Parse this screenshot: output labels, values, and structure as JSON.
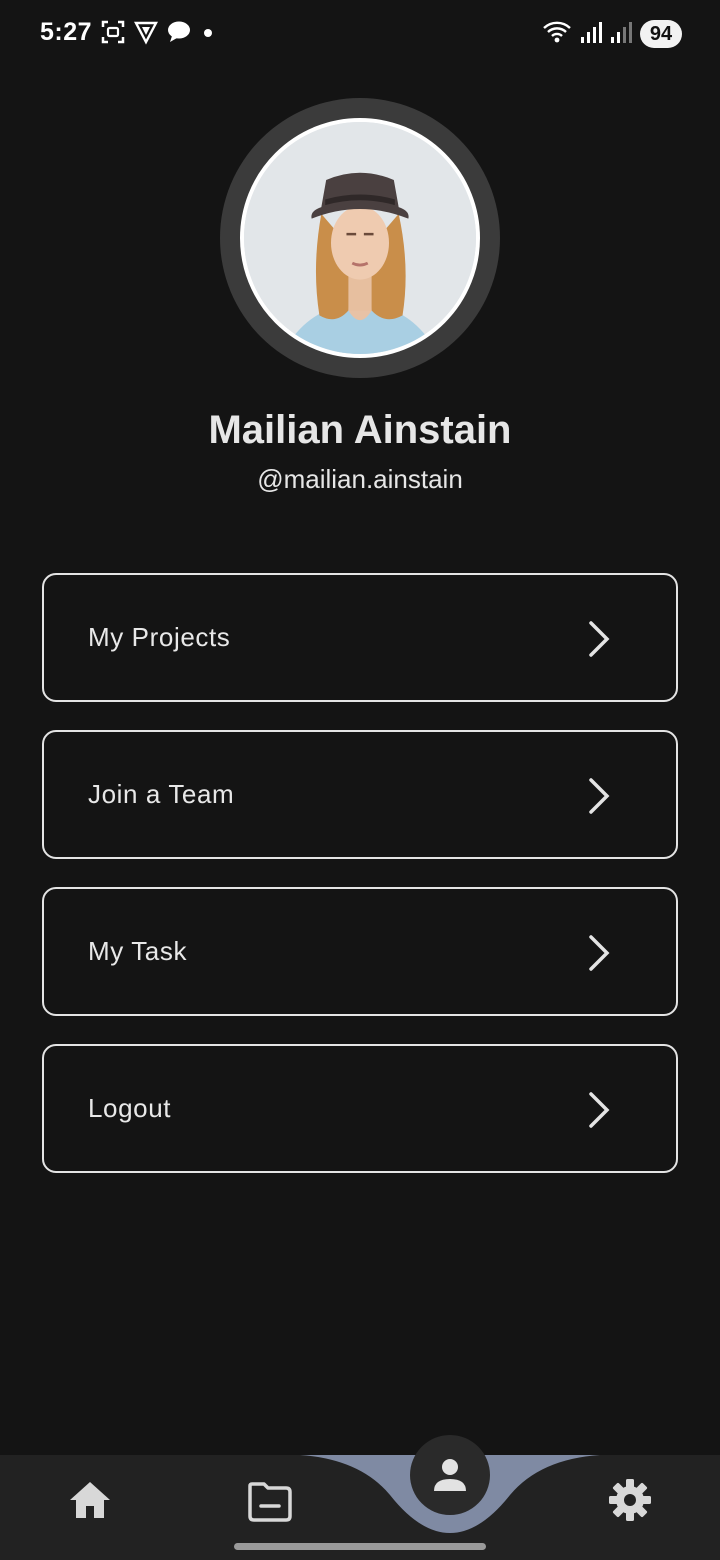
{
  "status_bar": {
    "time": "5:27",
    "battery": "94",
    "icons_left": [
      "screenshot-icon",
      "vpn-shield-icon",
      "chat-bubble-icon",
      "dot-icon"
    ],
    "icons_right": [
      "wifi-icon",
      "signal-icon",
      "signal-icon",
      "battery-icon"
    ]
  },
  "profile": {
    "name": "Mailian Ainstain",
    "handle": "@mailian.ainstain"
  },
  "menu": {
    "items": [
      {
        "label": "My Projects"
      },
      {
        "label": "Join a Team"
      },
      {
        "label": "My Task"
      },
      {
        "label": "Logout"
      }
    ]
  },
  "bottom_nav": {
    "items": [
      "home-icon",
      "folder-icon",
      "profile-icon",
      "settings-icon"
    ],
    "active": "profile-icon"
  },
  "colors": {
    "background": "#141414",
    "nav_background": "#222222",
    "nav_active_curve": "#7f8aa3",
    "card_border": "#e4e4e4",
    "text": "#e6e6e6"
  }
}
